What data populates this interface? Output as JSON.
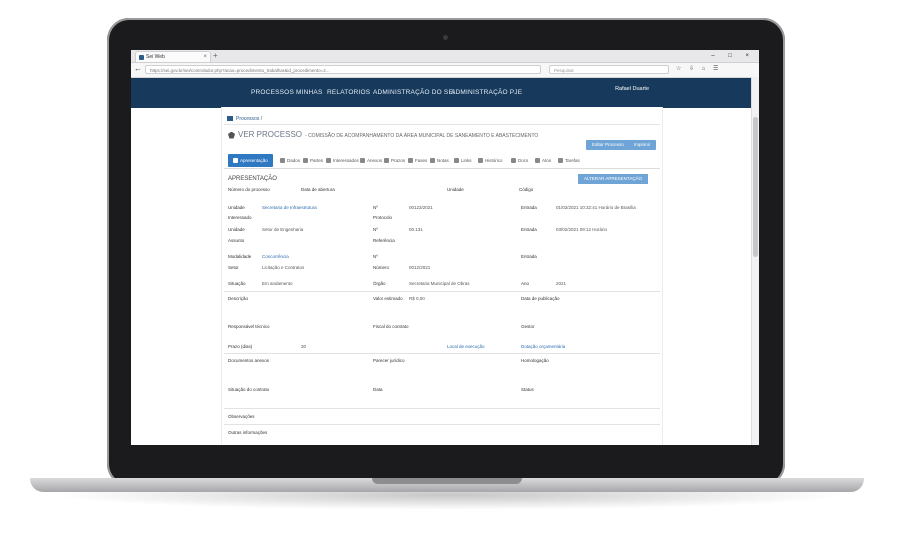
{
  "browser": {
    "tab_title": "Sei Web",
    "url": "https://sei.gov.br/sei/controlador.php?acao=procedimento_trabalhar&id_procedimento=2...",
    "search_placeholder": "Pesquisar",
    "win_controls": "– □ ×"
  },
  "nav": {
    "items": [
      "PROCESSOS",
      "MINHAS",
      "RELATORIOS",
      "ADMINISTRAÇÃO DO SEI",
      "ADMINISTRAÇÃO PJE"
    ],
    "user": "Rafael Duarte"
  },
  "breadcrumb": {
    "home": "Processos",
    "sep": "/"
  },
  "page": {
    "title": "VER PROCESSO",
    "subtitle": "- COMISSÃO DE ACOMPANHAMENTO DA ÁREA MUNICIPAL DE SANEAMENTO E ABASTECIMENTO",
    "btn_edit": "Editar Processo",
    "btn_print": "Imprimir"
  },
  "tabs": [
    {
      "label": "Apresentação",
      "active": true
    },
    {
      "label": "Dados",
      "active": false
    },
    {
      "label": "Partes",
      "active": false
    },
    {
      "label": "Interessados",
      "active": false
    },
    {
      "label": "Anexos",
      "active": false
    },
    {
      "label": "Prazos",
      "active": false
    },
    {
      "label": "Fases",
      "active": false
    },
    {
      "label": "Notas",
      "active": false
    },
    {
      "label": "Links",
      "active": false
    },
    {
      "label": "Histórico",
      "active": false
    },
    {
      "label": "Docs",
      "active": false
    },
    {
      "label": "Atos",
      "active": false
    },
    {
      "label": "Tarefas",
      "active": false
    }
  ],
  "section": {
    "title": "APRESENTAÇÃO",
    "action": "ALTERAR APRESENTAÇÃO"
  },
  "fields": {
    "r0": [
      "Número do processo",
      "Data de abertura",
      "Unidade",
      "Código"
    ],
    "r1": {
      "l1": "Unidade",
      "v1": "Secretaria de Infraestrutura",
      "l2": "Nº",
      "v2": "00123/2021",
      "l3": "Entrada",
      "v3": "01/02/2021 10:32:41 Horário de Brasília"
    },
    "r1b": {
      "l1": "Interessado",
      "l2": "Protocolo"
    },
    "r2": {
      "l1": "Unidade",
      "v1": "Setor de Engenharia",
      "l2": "Nº",
      "v2": "00.131",
      "l3": "Entrada",
      "v3": "03/02/2021 09:12 Horário"
    },
    "r2b": {
      "l1": "Assunto",
      "l2": "Referência"
    },
    "r3": {
      "l1": "Modalidade",
      "v1": "Concorrência",
      "l2": "Nº",
      "l3": "Entrada"
    },
    "r3b": {
      "l1": "Setor",
      "v1": "Licitação e Contratos",
      "l2": "Número",
      "v2": "0012/2021"
    },
    "r4": {
      "l1": "Situação",
      "v1": "Em andamento",
      "l2": "Órgão",
      "v2": "Secretaria Municipal de Obras",
      "l3": "Ano",
      "v3": "2021"
    },
    "r5": {
      "l1": "Descrição",
      "l2": "Valor estimado",
      "v2": "R$ 0,00",
      "l3": "Data de publicação"
    },
    "r6": {
      "l1": "Responsável técnico",
      "l2": "Fiscal do contrato",
      "l3": "Gestor"
    },
    "r7": {
      "l1": "Prazo (dias)",
      "v1": "30",
      "l2": "Local de execução",
      "v3": "Dotação orçamentária"
    },
    "r8": {
      "l1": "Documentos anexos",
      "l2": "Parecer jurídico",
      "l3": "Homologação"
    },
    "r9": {
      "l1": "Situação do contrato",
      "l2": "Data",
      "l3": "Status"
    },
    "r10": {
      "l1": "Observações"
    },
    "r11": {
      "l1": "Outras informações"
    }
  }
}
